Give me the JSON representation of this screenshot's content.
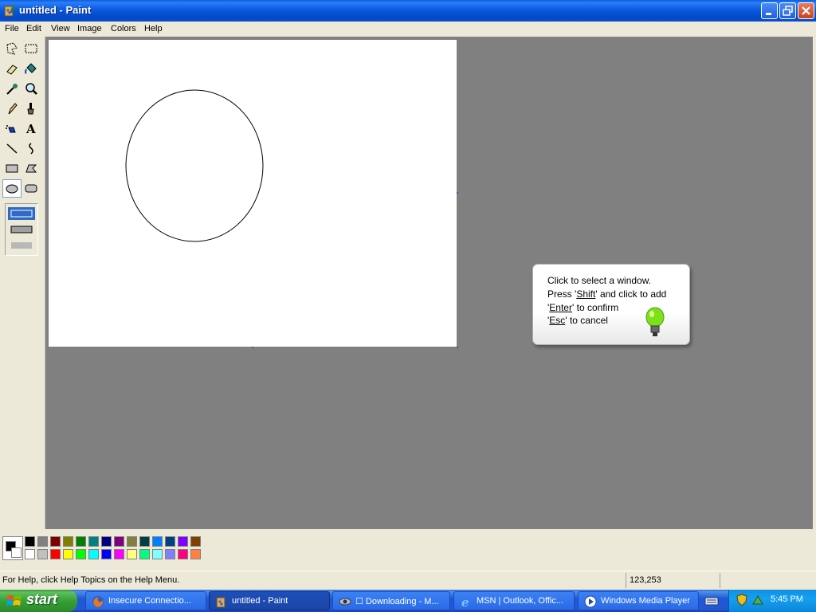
{
  "window": {
    "title": "untitled - Paint",
    "icon": "paint-palette-icon",
    "buttons": [
      "minimize-icon",
      "maximize-icon",
      "close-icon"
    ]
  },
  "menu": [
    "File",
    "Edit",
    "View",
    "Image",
    "Colors",
    "Help"
  ],
  "tools": [
    {
      "name": "free-form-select",
      "icon": "free-form-select-icon"
    },
    {
      "name": "select",
      "icon": "rect-select-icon"
    },
    {
      "name": "eraser",
      "icon": "eraser-icon"
    },
    {
      "name": "fill-with-color",
      "icon": "paint-bucket-icon"
    },
    {
      "name": "pick-color",
      "icon": "eyedropper-icon"
    },
    {
      "name": "magnifier",
      "icon": "magnifier-icon"
    },
    {
      "name": "pencil",
      "icon": "pencil-icon"
    },
    {
      "name": "brush",
      "icon": "brush-icon"
    },
    {
      "name": "airbrush",
      "icon": "airbrush-icon"
    },
    {
      "name": "text",
      "icon": "text-icon"
    },
    {
      "name": "line",
      "icon": "line-icon"
    },
    {
      "name": "curve",
      "icon": "curve-icon"
    },
    {
      "name": "rectangle",
      "icon": "rectangle-icon"
    },
    {
      "name": "polygon",
      "icon": "polygon-icon"
    },
    {
      "name": "ellipse",
      "icon": "ellipse-icon",
      "active": true
    },
    {
      "name": "rounded-rectangle",
      "icon": "rounded-rectangle-icon"
    }
  ],
  "fill_styles": {
    "selected_index": 0,
    "options": [
      "outline",
      "outline-fill",
      "fill"
    ]
  },
  "palette": {
    "foreground": "#000000",
    "background": "#ffffff",
    "top_row": [
      "#000000",
      "#808080",
      "#800000",
      "#808000",
      "#008000",
      "#008080",
      "#000080",
      "#800080",
      "#808040",
      "#004040",
      "#0080ff",
      "#004080",
      "#8000ff",
      "#804000"
    ],
    "bottom_row": [
      "#ffffff",
      "#c0c0c0",
      "#ff0000",
      "#ffff00",
      "#00ff00",
      "#00ffff",
      "#0000ff",
      "#ff00ff",
      "#ffff80",
      "#00ff80",
      "#80ffff",
      "#8080ff",
      "#ff0080",
      "#ff8040"
    ]
  },
  "status": {
    "help_text": "For Help, click Help Topics on the Help Menu.",
    "coordinates": "123,253"
  },
  "balloon": {
    "line1": "Click to select a window.",
    "line2_pre": "Press '",
    "line2_key": "Shift",
    "line2_post": "' and click to add",
    "line3_pre": "'",
    "line3_key": "Enter",
    "line3_post": "' to confirm",
    "line4_pre": "'",
    "line4_key": "Esc",
    "line4_post": "' to cancel",
    "icon": "lightbulb-icon"
  },
  "taskbar": {
    "start_label": "start",
    "tasks": [
      {
        "label": "Insecure Connectio...",
        "icon": "firefox-icon",
        "active": false
      },
      {
        "label": "untitled - Paint",
        "icon": "paint-palette-icon",
        "active": true
      },
      {
        "label": "☐ Downloading - M...",
        "icon": "download-manager-icon",
        "active": false
      },
      {
        "label": "MSN | Outlook, Offic...",
        "icon": "internet-explorer-icon",
        "active": false
      },
      {
        "label": "Windows Media Player",
        "icon": "media-player-icon",
        "active": false
      }
    ],
    "clock": "5:45 PM",
    "tray_icons": [
      "security-shield-icon",
      "network-icon"
    ]
  },
  "colors": {
    "titlebar": "#0a5be0",
    "workspace": "#808080",
    "canvas": "#ffffff",
    "taskbar": "#2157d7",
    "start": "#35a035"
  }
}
